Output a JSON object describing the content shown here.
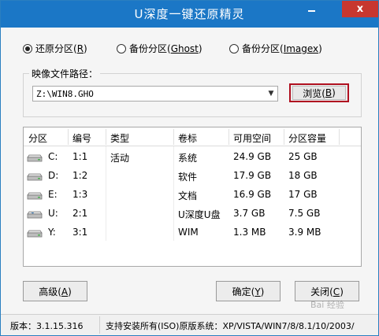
{
  "window": {
    "title": "U深度一键还原精灵",
    "minimize_label": "",
    "close_label": "x"
  },
  "mode_options": [
    {
      "label": "还原分区(",
      "key": "R",
      "suffix": ")",
      "selected": true
    },
    {
      "label": "备份分区(",
      "key": "Ghost",
      "suffix": ")",
      "selected": false
    },
    {
      "label": "备份分区(",
      "key": "Imagex",
      "suffix": ")",
      "selected": false
    }
  ],
  "image_path": {
    "label": "映像文件路径：",
    "value": "Z:\\WIN8.GHO"
  },
  "browse_button": {
    "label": "浏览(",
    "key": "B",
    "suffix": ")"
  },
  "table": {
    "columns": [
      "分区",
      "编号",
      "类型",
      "卷标",
      "可用空间",
      "分区容量"
    ],
    "rows": [
      {
        "drive": "C:",
        "id": "1:1",
        "type": "活动",
        "label": "系统",
        "free": "24.9 GB",
        "size": "25 GB",
        "icon": "hdd-icon"
      },
      {
        "drive": "D:",
        "id": "1:2",
        "type": "",
        "label": "软件",
        "free": "17.9 GB",
        "size": "18 GB",
        "icon": "hdd-icon"
      },
      {
        "drive": "E:",
        "id": "1:3",
        "type": "",
        "label": "文档",
        "free": "16.9 GB",
        "size": "17 GB",
        "icon": "hdd-icon"
      },
      {
        "drive": "U:",
        "id": "2:1",
        "type": "",
        "label": "U深度U盘",
        "free": "3.7 GB",
        "size": "7.5 GB",
        "icon": "usb-drive-icon"
      },
      {
        "drive": "Y:",
        "id": "3:1",
        "type": "",
        "label": "WIM",
        "free": "1.3 MB",
        "size": "3.9 MB",
        "icon": "hdd-icon"
      }
    ]
  },
  "buttons": {
    "advanced": {
      "label": "高级(",
      "key": "A",
      "suffix": ")"
    },
    "ok": {
      "label": "确定(",
      "key": "Y",
      "suffix": ")"
    },
    "close": {
      "label": "关闭(",
      "key": "C",
      "suffix": ")"
    }
  },
  "status": {
    "version": "版本：3.1.15.316",
    "systems": "支持安装所有(ISO)原版系统：XP/VISTA/WIN7/8/8.1/10/2003/"
  },
  "watermark": "Bai 经验",
  "colors": {
    "titlebar": "#1b77c6",
    "close_button": "#c7372f",
    "browse_highlight": "#b01020"
  }
}
